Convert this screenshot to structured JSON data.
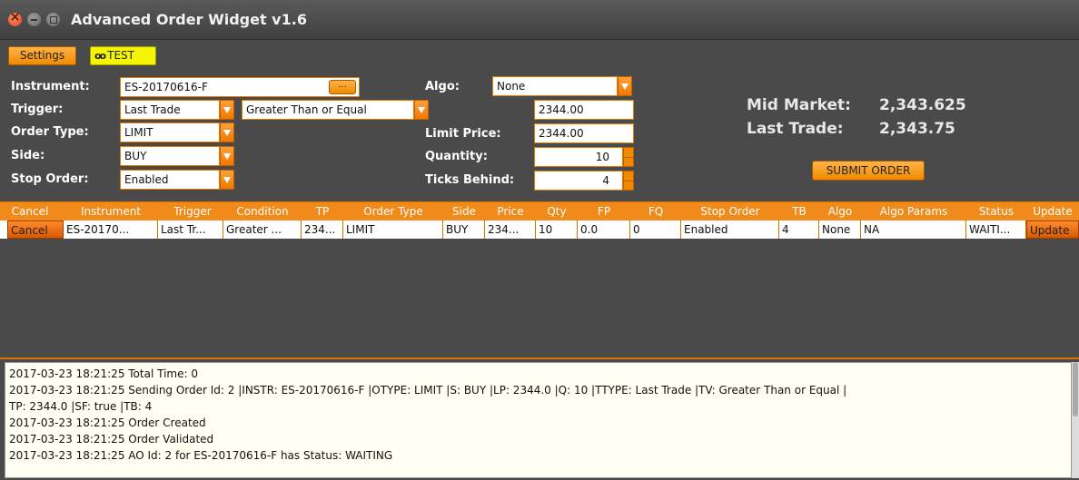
{
  "window": {
    "title": "Advanced Order Widget v1.6"
  },
  "toolbar": {
    "settings_label": "Settings",
    "test_label": "TEST"
  },
  "form": {
    "instrument_label": "Instrument:",
    "instrument_value": "ES-20170616-F",
    "instrument_button": "...",
    "trigger_label": "Trigger:",
    "trigger_value": "Last Trade",
    "condition_value": "Greater Than or Equal",
    "trigger_price": "2344.00",
    "order_type_label": "Order Type:",
    "order_type_value": "LIMIT",
    "side_label": "Side:",
    "side_value": "BUY",
    "stop_order_label": "Stop Order:",
    "stop_order_value": "Enabled",
    "algo_label": "Algo:",
    "algo_value": "None",
    "limit_price_label": "Limit Price:",
    "limit_price_value": "2344.00",
    "quantity_label": "Quantity:",
    "quantity_value": "10",
    "ticks_behind_label": "Ticks Behind:",
    "ticks_behind_value": "4"
  },
  "market": {
    "mid_label": "Mid Market:",
    "mid_value": "2,343.625",
    "last_label": "Last Trade:",
    "last_value": "2,343.75",
    "submit_label": "SUBMIT ORDER"
  },
  "orders_table": {
    "columns": [
      "Cancel",
      "Instrument",
      "Trigger",
      "Condition",
      "TP",
      "Order Type",
      "Side",
      "Price",
      "Qty",
      "FP",
      "FQ",
      "Stop Order",
      "TB",
      "Algo",
      "Algo Params",
      "Status",
      "Update"
    ],
    "rows": [
      [
        "Cancel",
        "ES-20170...",
        "Last Tr...",
        "Greater ...",
        "234...",
        "LIMIT",
        "BUY",
        "234...",
        "10",
        "0.0",
        "0",
        "Enabled",
        "4",
        "None",
        "NA",
        "WAITI...",
        "Update"
      ]
    ]
  },
  "log": {
    "lines": [
      "2017-03-23 18:21:25 Total Time: 0",
      "2017-03-23 18:21:25 Sending Order Id: 2 |INSTR: ES-20170616-F |OTYPE: LIMIT |S: BUY |LP: 2344.0 |Q: 10 |TTYPE: Last Trade |TV: Greater Than or Equal |",
      "TP: 2344.0 |SF: true |TB: 4",
      "2017-03-23 18:21:25 Order Created",
      "2017-03-23 18:21:25 Order Validated",
      "2017-03-23 18:21:25 AO Id: 2 for ES-20170616-F has Status: WAITING"
    ]
  }
}
